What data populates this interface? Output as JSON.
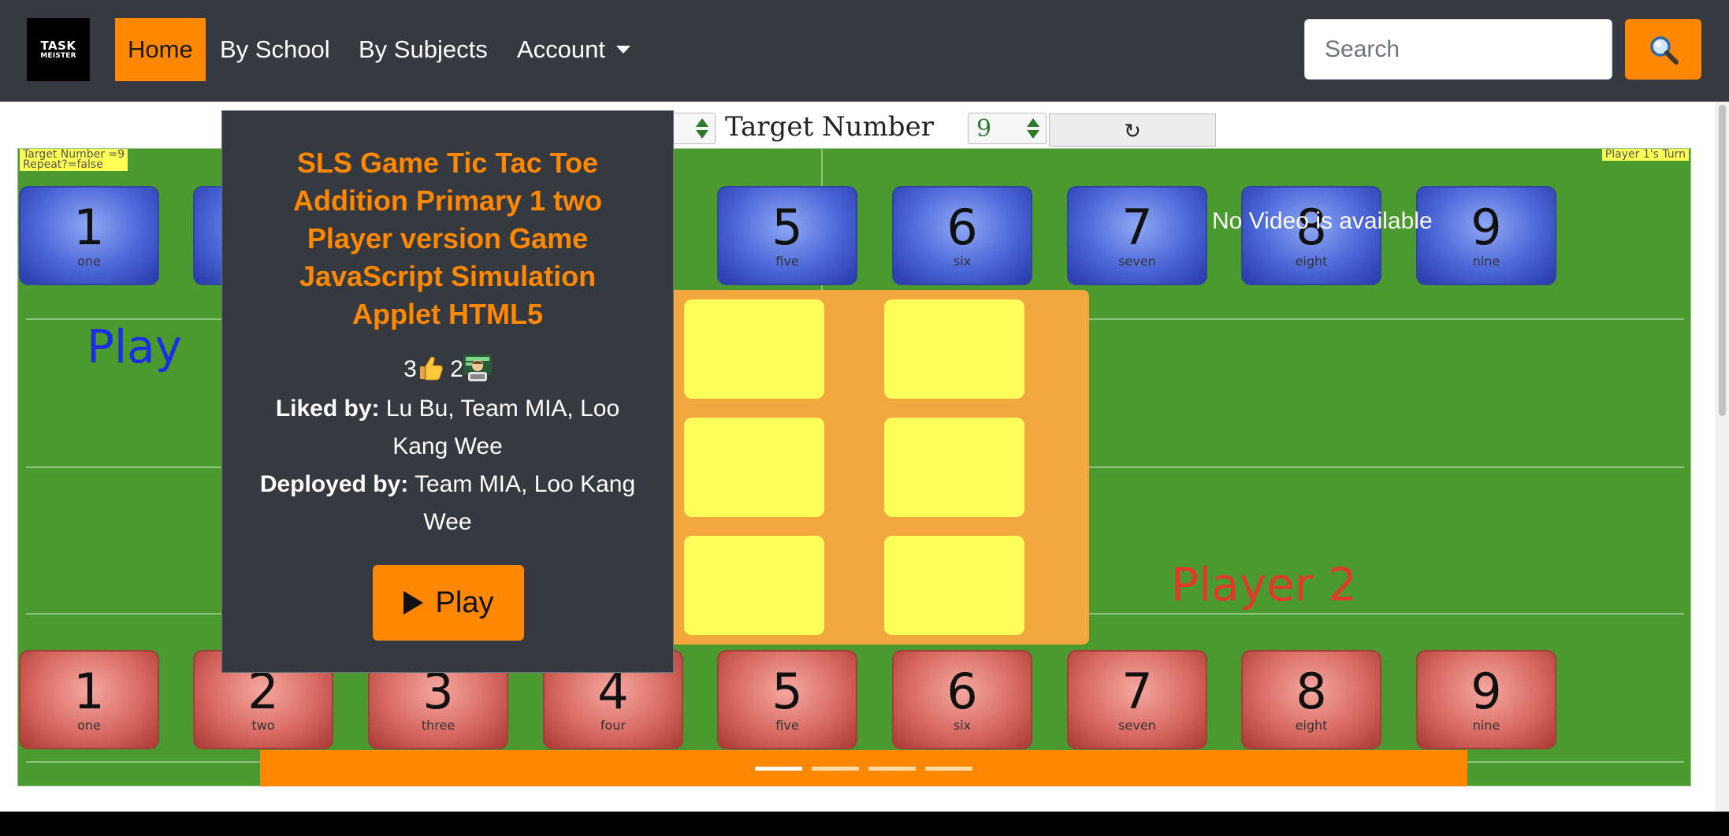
{
  "navbar": {
    "logo_line1": "TASK",
    "logo_line2": "MEISTER",
    "items": [
      {
        "label": "Home",
        "active": true
      },
      {
        "label": "By School"
      },
      {
        "label": "By Subjects"
      },
      {
        "label": "Account"
      }
    ],
    "search_placeholder": "Search",
    "accent_color": "#ff8800"
  },
  "simulation": {
    "target_label": "Target Number",
    "target_value": "9",
    "reset_symbol": "↻",
    "info_left_line1": "Target Number =9",
    "info_left_line2": "Repeat?=false",
    "info_right": "Player 1's Turn",
    "player1_label": "Play",
    "player2_label": "Player 2",
    "no_video": "No Video is available",
    "blue_tiles": [
      {
        "n": "1",
        "w": "one"
      },
      {
        "n": "5",
        "w": "five"
      },
      {
        "n": "6",
        "w": "six"
      },
      {
        "n": "7",
        "w": "seven"
      },
      {
        "n": "8",
        "w": "eight"
      },
      {
        "n": "9",
        "w": "nine"
      }
    ],
    "red_tiles": [
      {
        "n": "1",
        "w": "one"
      },
      {
        "n": "2",
        "w": "two"
      },
      {
        "n": "3",
        "w": "three"
      },
      {
        "n": "4",
        "w": "four"
      },
      {
        "n": "5",
        "w": "five"
      },
      {
        "n": "6",
        "w": "six"
      },
      {
        "n": "7",
        "w": "seven"
      },
      {
        "n": "8",
        "w": "eight"
      },
      {
        "n": "9",
        "w": "nine"
      }
    ]
  },
  "card": {
    "title": "SLS Game Tic Tac Toe Addition Primary 1 two Player version Game JavaScript Simulation Applet HTML5",
    "likes": "3",
    "deploys": "2",
    "liked_by_label": "Liked by:",
    "liked_by": "Lu Bu, Team MIA, Loo Kang Wee",
    "deployed_by_label": "Deployed by:",
    "deployed_by": "Team MIA, Loo Kang Wee",
    "play_label": "Play"
  },
  "carousel": {
    "slides": 4,
    "active_index": 0
  }
}
